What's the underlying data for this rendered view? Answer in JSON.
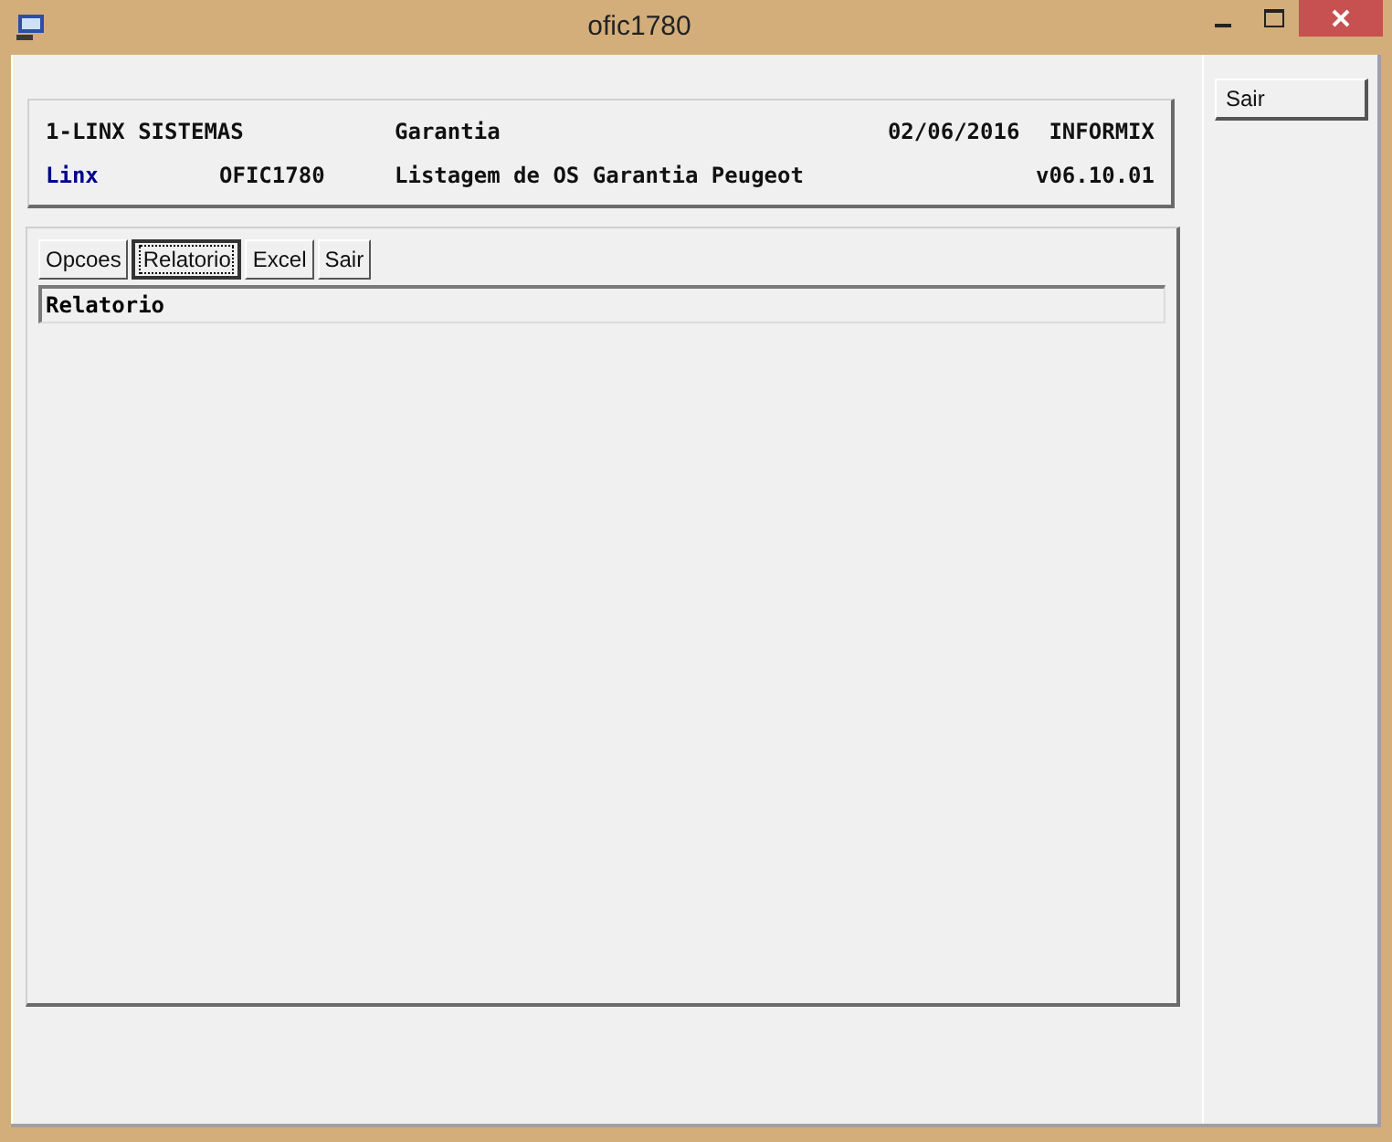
{
  "window": {
    "title": "ofic1780"
  },
  "header": {
    "company": "1-LINX SISTEMAS",
    "module": "Garantia",
    "date": "02/06/2016",
    "database": "INFORMIX",
    "user": "Linx",
    "program": "OFIC1780",
    "description": "Listagem de OS Garantia Peugeot",
    "version": "v06.10.01"
  },
  "toolbar": [
    {
      "label": "Opcoes",
      "selected": false
    },
    {
      "label": "Relatorio",
      "selected": true
    },
    {
      "label": "Excel",
      "selected": false
    },
    {
      "label": "Sair",
      "selected": false
    }
  ],
  "section_title": "Relatorio",
  "side_buttons": [
    "Sair"
  ]
}
